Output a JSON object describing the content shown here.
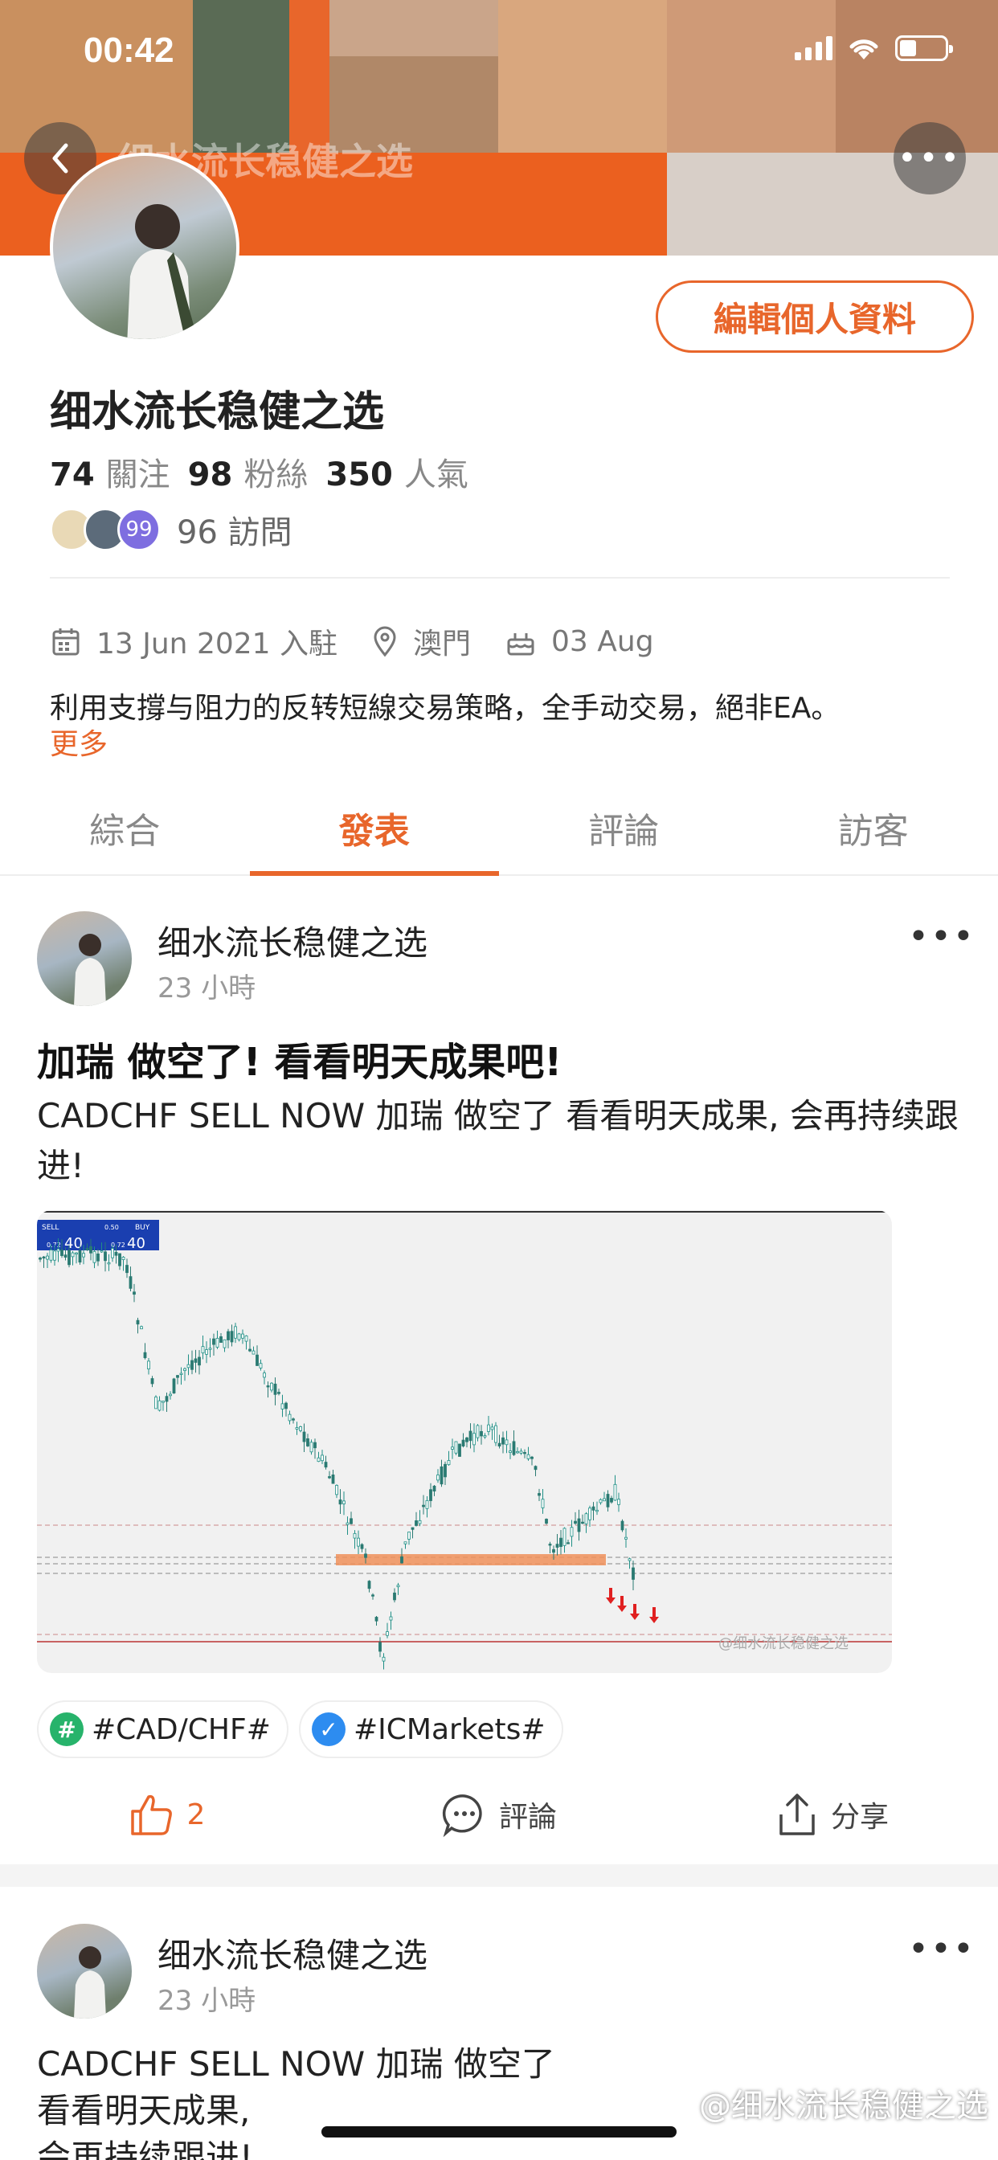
{
  "status_bar": {
    "time": "00:42"
  },
  "header": {
    "title": "细水流长稳健之选",
    "back_icon": "chevron-left-icon",
    "more_icon": "more-horizontal-icon",
    "brand_color": "#e8662b"
  },
  "profile": {
    "edit_button": "編輯個人資料",
    "name": "细水流长稳健之选",
    "following_count": "74",
    "following_label": "關注",
    "fans_count": "98",
    "fans_label": "粉絲",
    "popularity_count": "350",
    "popularity_label": "人氣",
    "visitor_badge": "99",
    "visits_text": "96 訪問",
    "joined": "13 Jun 2021 入駐",
    "location": "澳門",
    "birthday": "03 Aug",
    "bio": "利用支撐与阻力的反转短線交易策略，全手动交易，絕非EA。",
    "more_link": "更多"
  },
  "tabs": [
    {
      "label": "綜合",
      "active": false
    },
    {
      "label": "發表",
      "active": true
    },
    {
      "label": "評論",
      "active": false
    },
    {
      "label": "訪客",
      "active": false
    }
  ],
  "posts": [
    {
      "author": "细水流长稳健之选",
      "time": "23 小時",
      "title": "加瑞 做空了! 看看明天成果吧!",
      "body": "CADCHF SELL NOW 加瑞 做空了 看看明天成果, 会再持续跟进!",
      "chart": {
        "sell_label": "SELL",
        "buy_label": "BUY",
        "sell_price": "40",
        "buy_price": "40",
        "lot": "0.50",
        "sell_prefix": "0.72",
        "buy_prefix": "0.72",
        "watermark": "@细水流长稳健之选"
      },
      "tags": [
        "#CAD/CHF#",
        "#ICMarkets#"
      ],
      "likes": "2",
      "comment_label": "評論",
      "share_label": "分享"
    },
    {
      "author": "细水流长稳健之选",
      "time": "23 小時",
      "body_lines": [
        "CADCHF SELL NOW 加瑞 做空了",
        "看看明天成果,",
        "会再持续跟进!"
      ]
    }
  ],
  "page_watermark": "@细水流长稳健之选"
}
